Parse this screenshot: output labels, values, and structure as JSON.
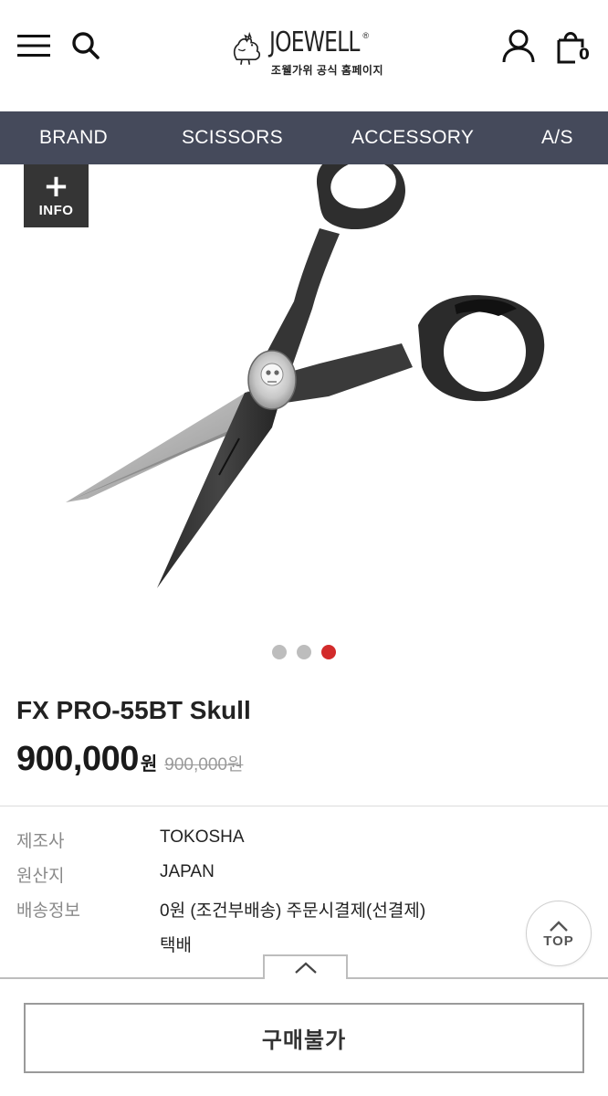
{
  "header": {
    "logo_word": "JOEWELL",
    "logo_registered": "®",
    "logo_subtitle": "조웰가위 공식 홈페이지",
    "cart_count": "0",
    "icons": [
      "menu-icon",
      "search-icon",
      "rooster-logo-icon",
      "user-icon",
      "cart-icon"
    ]
  },
  "nav": {
    "items": [
      {
        "label": "BRAND"
      },
      {
        "label": "SCISSORS"
      },
      {
        "label": "ACCESSORY"
      },
      {
        "label": "A/S"
      }
    ]
  },
  "gallery": {
    "info_plus": "+",
    "info_label": "INFO",
    "slide_count": 3,
    "active_slide": 3
  },
  "product": {
    "name": "FX PRO-55BT Skull",
    "price": "900,000",
    "price_unit": "원",
    "original_price": "900,000원",
    "details": [
      {
        "label": "제조사",
        "value": "TOKOSHA"
      },
      {
        "label": "원산지",
        "value": "JAPAN"
      },
      {
        "label": "배송정보",
        "value": "0원 (조건부배송) 주문시결제(선결제)"
      },
      {
        "label": "",
        "value": "택배"
      }
    ]
  },
  "top_button": {
    "label": "TOP"
  },
  "purchase": {
    "button_label": "구매불가"
  },
  "colors": {
    "nav_bg": "#454a5b",
    "active_dot": "#d22b2b",
    "inactive_dot": "#bdbdbd",
    "info_bg": "#353535"
  }
}
